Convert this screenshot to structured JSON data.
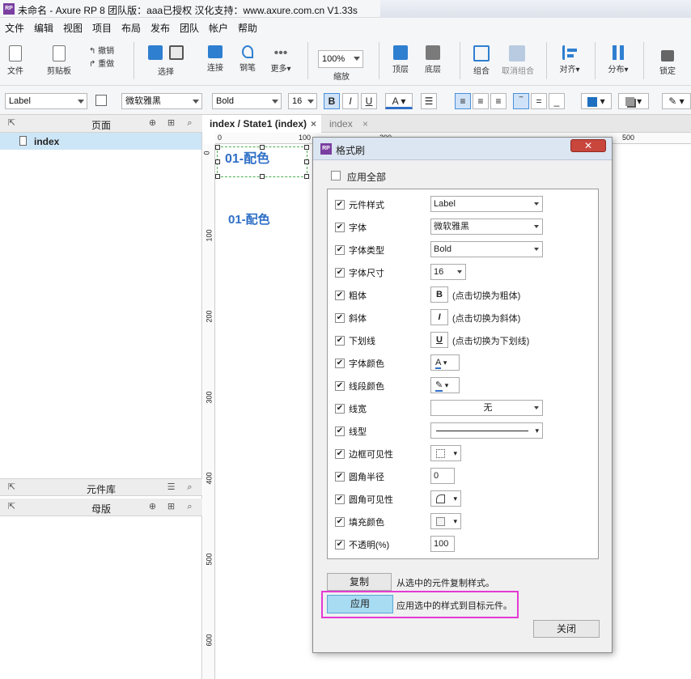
{
  "window": {
    "title": "未命名 - Axure RP 8 团队版：aaa已授权 汉化支持：www.axure.com.cn V1.33s",
    "logo": "RP"
  },
  "menu": [
    "文件",
    "编辑",
    "视图",
    "项目",
    "布局",
    "发布",
    "团队",
    "帐户",
    "帮助"
  ],
  "toolbar": {
    "file": "文件",
    "clipboard": "剪贴板",
    "undo": "撤销",
    "redo": "重做",
    "select": "选择",
    "connect": "连接",
    "pen": "钢笔",
    "more": "更多▾",
    "zoom_value": "100%",
    "zoom_label": "缩放",
    "top": "顶层",
    "bottom": "底层",
    "group": "组合",
    "ungroup": "取消组合",
    "align": "对齐▾",
    "distribute": "分布▾",
    "lock": "锁定"
  },
  "formatbar": {
    "style": "Label",
    "font": "微软雅黑",
    "weight": "Bold",
    "size": "16",
    "bold": "B",
    "italic": "I",
    "underline": "U",
    "color": "A"
  },
  "left": {
    "pages_title": "页面",
    "page_item": "index",
    "library_title": "元件库",
    "masters_title": "母版"
  },
  "tabs": [
    {
      "label": "index / State1 (index)",
      "close": "×"
    },
    {
      "label": "index",
      "close": "×"
    }
  ],
  "canvas": {
    "label_selected": "01-配色",
    "label_other": "01-配色",
    "ruler_h": [
      "0",
      "100",
      "200",
      "300",
      "400",
      "500"
    ],
    "ruler_v": [
      "0",
      "100",
      "200",
      "300",
      "400",
      "500",
      "600"
    ]
  },
  "dialog": {
    "logo": "RP",
    "title": "格式刷",
    "apply_all": "应用全部",
    "rows": [
      {
        "label": "元件样式",
        "value": "Label",
        "kind": "select"
      },
      {
        "label": "字体",
        "value": "微软雅黑",
        "kind": "select"
      },
      {
        "label": "字体类型",
        "value": "Bold",
        "kind": "select"
      },
      {
        "label": "字体尺寸",
        "value": "16",
        "kind": "small-select"
      },
      {
        "label": "粗体",
        "value": "B",
        "note": "(点击切换为粗体)",
        "kind": "toggle"
      },
      {
        "label": "斜体",
        "value": "I",
        "note": "(点击切换为斜体)",
        "kind": "toggle"
      },
      {
        "label": "下划线",
        "value": "U",
        "note": "(点击切换为下划线)",
        "kind": "toggle"
      },
      {
        "label": "字体颜色",
        "value": "A",
        "kind": "color"
      },
      {
        "label": "线段颜色",
        "value": "✎",
        "kind": "color"
      },
      {
        "label": "线宽",
        "value": "无",
        "kind": "select-center"
      },
      {
        "label": "线型",
        "value": "",
        "kind": "line"
      },
      {
        "label": "边框可见性",
        "value": "",
        "kind": "border"
      },
      {
        "label": "圆角半径",
        "value": "0",
        "kind": "input"
      },
      {
        "label": "圆角可见性",
        "value": "",
        "kind": "corner"
      },
      {
        "label": "填充颜色",
        "value": "",
        "kind": "fill"
      },
      {
        "label": "不透明(%)",
        "value": "100",
        "kind": "input"
      }
    ],
    "copy_button": "复制",
    "copy_desc": "从选中的元件复制样式。",
    "apply_button": "应用",
    "apply_desc": "应用选中的样式到目标元件。",
    "close_button": "关闭"
  },
  "colors": {
    "accent": "#2f6fc6",
    "highlight": "#e33ad4",
    "apply_bg": "#a8dcf2",
    "selection": "#cfe2f7"
  }
}
